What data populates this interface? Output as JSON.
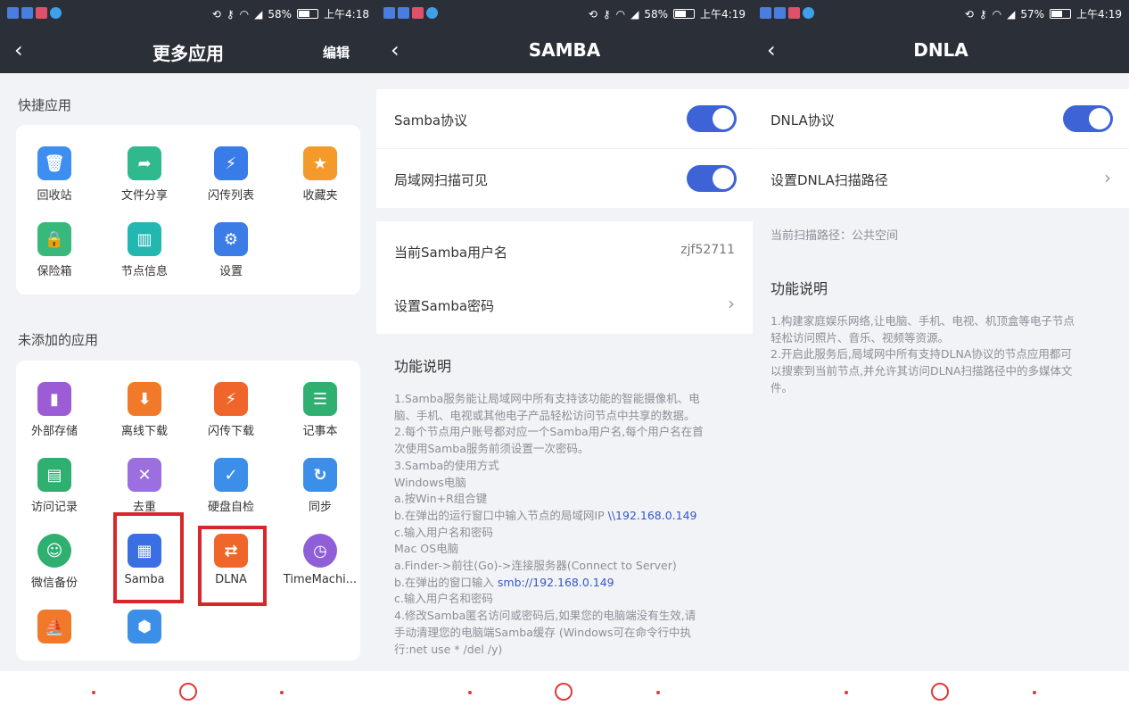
{
  "status_bars": [
    {
      "battery": "58%",
      "time": "上午4:18"
    },
    {
      "battery": "58%",
      "time": "上午4:19"
    },
    {
      "battery": "57%",
      "time": "上午4:19"
    }
  ],
  "more_apps": {
    "title": "更多应用",
    "edit_label": "编辑",
    "quick_section": "快捷应用",
    "quick_apps": [
      {
        "label": "回收站",
        "icon": "trash-icon",
        "color": "#3d8ef0"
      },
      {
        "label": "文件分享",
        "icon": "share-folder-icon",
        "color": "#2fb98c"
      },
      {
        "label": "闪传列表",
        "icon": "flash-list-icon",
        "color": "#3a7bea"
      },
      {
        "label": "收藏夹",
        "icon": "star-folder-icon",
        "color": "#f39a2b"
      },
      {
        "label": "保险箱",
        "icon": "safe-icon",
        "color": "#38b87a"
      },
      {
        "label": "节点信息",
        "icon": "node-info-icon",
        "color": "#22b7b0"
      },
      {
        "label": "设置",
        "icon": "gear-icon",
        "color": "#3b7ce6"
      }
    ],
    "unadded_section": "未添加的应用",
    "unadded_apps": [
      {
        "label": "外部存储",
        "icon": "usb-icon",
        "color": "#9b5cd6"
      },
      {
        "label": "离线下载",
        "icon": "download-icon",
        "color": "#f07a2a"
      },
      {
        "label": "闪传下载",
        "icon": "flash-download-icon",
        "color": "#f0662a"
      },
      {
        "label": "记事本",
        "icon": "notepad-icon",
        "color": "#2fb071"
      },
      {
        "label": "访问记录",
        "icon": "access-log-icon",
        "color": "#2fb071"
      },
      {
        "label": "去重",
        "icon": "dedupe-icon",
        "color": "#9b6fe0"
      },
      {
        "label": "硬盘自检",
        "icon": "disk-check-icon",
        "color": "#3b8fe8"
      },
      {
        "label": "同步",
        "icon": "sync-icon",
        "color": "#3b8fe8"
      },
      {
        "label": "微信备份",
        "icon": "wechat-backup-icon",
        "color": "#2fb071"
      },
      {
        "label": "Samba",
        "icon": "samba-icon",
        "color": "#3a6fe3"
      },
      {
        "label": "DLNA",
        "icon": "dlna-icon",
        "color": "#f0662a"
      },
      {
        "label": "TimeMachi...",
        "icon": "time-machine-icon",
        "color": "#8f5fd8"
      },
      {
        "label": "",
        "icon": "boat-icon",
        "color": "#f07a2a"
      },
      {
        "label": "",
        "icon": "shield-app-icon",
        "color": "#3b8fe8"
      }
    ]
  },
  "samba": {
    "title": "SAMBA",
    "protocol_label": "Samba协议",
    "protocol_on": true,
    "lan_visible_label": "局域网扫描可见",
    "lan_visible_on": true,
    "username_label": "当前Samba用户名",
    "username_value": "zjf52711",
    "password_label": "设置Samba密码",
    "func_title": "功能说明",
    "desc_lines": [
      "1.Samba服务能让局域网中所有支持该功能的智能摄像机、电",
      "脑、手机、电视或其他电子产品轻松访问节点中共享的数据。",
      "2.每个节点用户账号都对应一个Samba用户名,每个用户名在首",
      "次使用Samba服务前须设置一次密码。",
      "3.Samba的使用方式",
      "Windows电脑",
      "a.按Win+R组合键",
      "b.在弹出的运行窗口中输入节点的局域网IP",
      "c.输入用户名和密码",
      "Mac OS电脑",
      "a.Finder->前往(Go)->连接服务器(Connect to Server)",
      "b.在弹出的窗口输入",
      "c.输入用户名和密码",
      "4.修改Samba匿名访问或密码后,如果您的电脑端没有生效,请",
      "手动清理您的电脑端Samba缓存 (Windows可在命令行中执",
      "行:net use * /del /y)"
    ],
    "win_link": "\\\\192.168.0.149",
    "mac_link": "smb://192.168.0.149"
  },
  "dnla": {
    "title": "DNLA",
    "protocol_label": "DNLA协议",
    "protocol_on": true,
    "scan_path_label": "设置DNLA扫描路径",
    "current_path": "当前扫描路径：公共空间",
    "func_title": "功能说明",
    "desc_lines": [
      "1.构建家庭娱乐网络,让电脑、手机、电视、机顶盒等电子节点",
      "轻松访问照片、音乐、视频等资源。",
      "2.开启此服务后,局域网中所有支持DLNA协议的节点应用都可",
      "以搜索到当前节点,并允许其访问DLNA扫描路径中的多媒体文",
      "件。"
    ]
  },
  "colors": {
    "header_bg": "#2b3038",
    "toggle_on": "#3d63d7",
    "highlight_box": "#d8262b",
    "link": "#3357c9"
  }
}
